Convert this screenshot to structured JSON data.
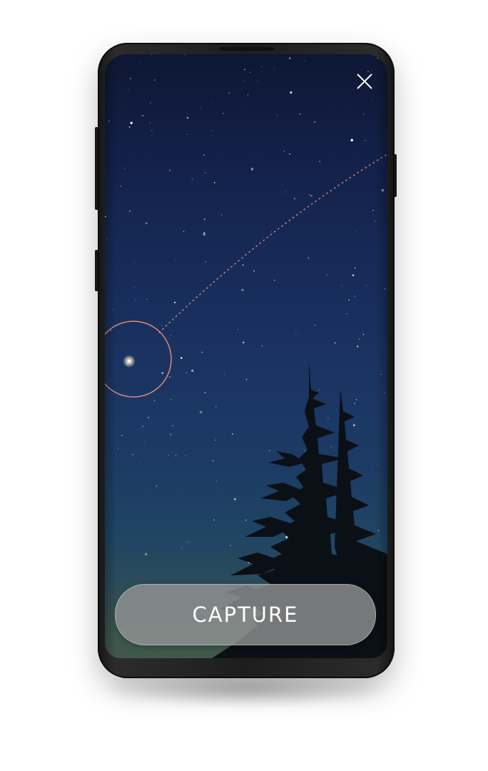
{
  "app": {
    "capture_label": "CAPTURE",
    "close_icon": "close-icon"
  },
  "colors": {
    "sky_top": "#0e1733",
    "sky_mid": "#1b3563",
    "horizon": "#3f5a4a",
    "target_ring": "#e08a7a",
    "trajectory": "#d98a78",
    "button_bg": "#969696",
    "button_text": "#ffffff"
  },
  "target": {
    "icon": "target-ring",
    "label": ""
  }
}
